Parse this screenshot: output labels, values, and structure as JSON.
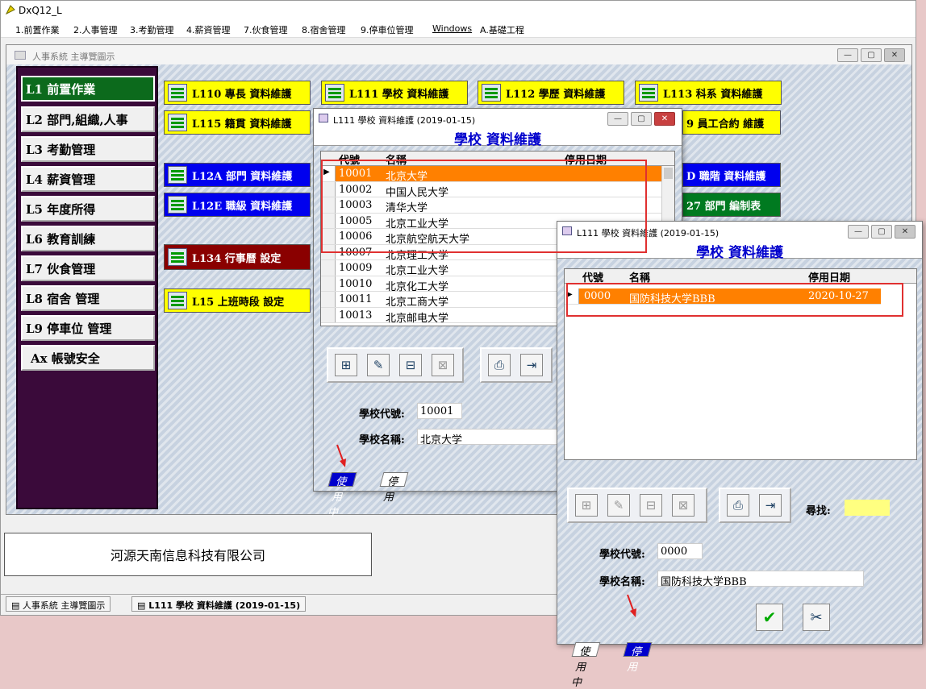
{
  "app": {
    "title": "DxQ12_L"
  },
  "menu": [
    "1.前置作業",
    "2.人事管理",
    "3.考勤管理",
    "4.薪資管理",
    "7.伙食管理",
    "8.宿舍管理",
    "9.停車位管理",
    "Windows",
    "A.基礎工程"
  ],
  "child": {
    "title": "人事系統 主導覽圖示"
  },
  "nav": [
    "L1 前置作業",
    "L2 部門,組織,人事",
    "L3 考勤管理",
    "L4 薪資管理",
    "L5 年度所得",
    "L6 教育訓練",
    "L7 伙食管理",
    "L8 宿舍 管理",
    "L9 停車位 管理",
    "Ax 帳號安全"
  ],
  "tiles": {
    "t110": "L110 專長 資料維護",
    "t111": "L111 學校 資料維護",
    "t112": "L112 學歷 資料維護",
    "t113": "L113 科系 資料維護",
    "t115": "L115 籍貫 資料維護",
    "t119": "9 員工合約 維護",
    "t12a": "L12A 部門 資料維護",
    "t12e": "L12E 職級 資料維護",
    "t12d": "D 職階 資料維護",
    "t127": "27 部門 編制表",
    "t134": "L134 行事曆 設定",
    "t15": "L15 上班時段 設定"
  },
  "company": "河源天南信息科技有限公司",
  "taskbar": {
    "t1": "人事系統 主導覽圖示",
    "t2": "L111 學校 資料維護 (2019-01-15)"
  },
  "dlg1": {
    "title": "L111 學校 資料維護 (2019-01-15)",
    "header": "學校 資料維護",
    "cols": {
      "code": "代號",
      "name": "名稱",
      "stop": "停用日期"
    },
    "rows": [
      {
        "code": "10001",
        "name": "北京大学"
      },
      {
        "code": "10002",
        "name": "中国人民大学"
      },
      {
        "code": "10003",
        "name": "清华大学"
      },
      {
        "code": "10005",
        "name": "北京工业大学"
      },
      {
        "code": "10006",
        "name": "北京航空航天大学"
      },
      {
        "code": "10007",
        "name": "北京理工大学"
      },
      {
        "code": "10009",
        "name": "北京工业大学"
      },
      {
        "code": "10010",
        "name": "北京化工大学"
      },
      {
        "code": "10011",
        "name": "北京工商大学"
      },
      {
        "code": "10013",
        "name": "北京邮电大学"
      }
    ],
    "code_label": "學校代號:",
    "code_value": "10001",
    "name_label": "學校名稱:",
    "name_value": "北京大学",
    "tab_active": "使用中",
    "tab_other": "停用"
  },
  "dlg2": {
    "title": "L111 學校 資料維護 (2019-01-15)",
    "header": "學校 資料維護",
    "cols": {
      "code": "代號",
      "name": "名稱",
      "stop": "停用日期"
    },
    "row": {
      "code": "0000",
      "name": "国防科技大学BBB",
      "stop": "2020-10-27"
    },
    "find_label": "尋找:",
    "code_label": "學校代號:",
    "code_value": "0000",
    "name_label": "學校名稱:",
    "name_value": "国防科技大学BBB",
    "tab_other": "使用中",
    "tab_active": "停用"
  },
  "colors": {
    "nav_bg": "#3a0a3a",
    "selected_row": "#ff8000",
    "highlight": "#e03030",
    "active_tab": "#0000cc"
  },
  "icons": {
    "ok": "check-icon",
    "cancel": "scissors-icon",
    "print": "printer-icon",
    "exit": "exit-door-icon"
  }
}
